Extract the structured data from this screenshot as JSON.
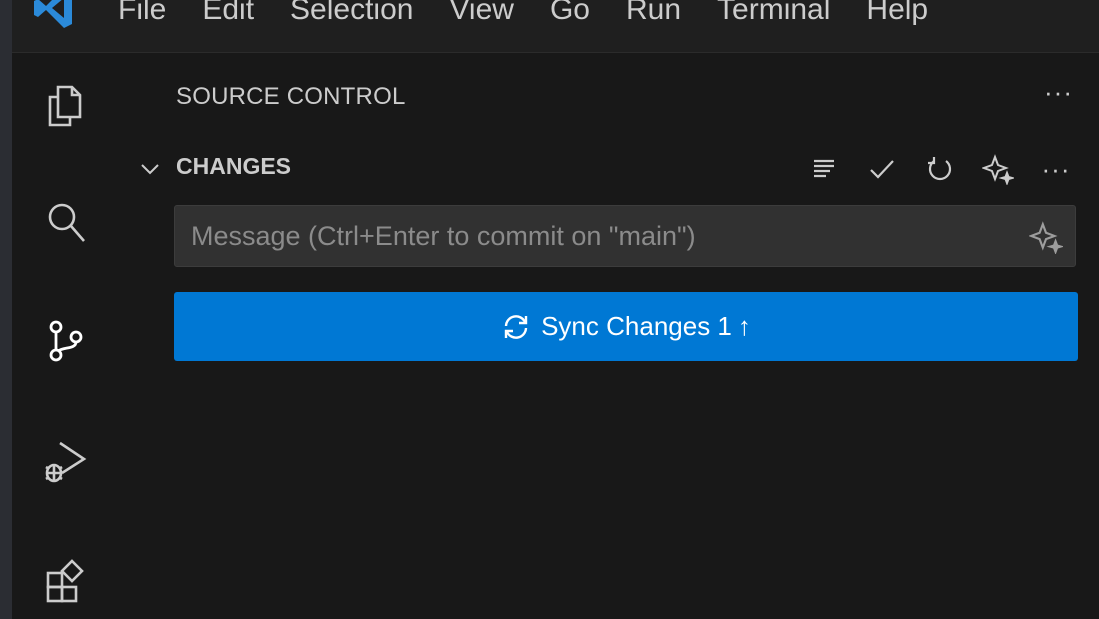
{
  "menubar": {
    "items": [
      "File",
      "Edit",
      "Selection",
      "View",
      "Go",
      "Run",
      "Terminal",
      "Help"
    ]
  },
  "activitybar": {
    "icons": [
      "explorer-icon",
      "search-icon",
      "source-control-icon",
      "run-debug-icon",
      "extensions-icon"
    ]
  },
  "sidebar": {
    "title": "SOURCE CONTROL",
    "more": "···",
    "section": {
      "label": "CHANGES",
      "actions": [
        "view-as-tree-icon",
        "commit-check-icon",
        "refresh-icon",
        "sparkle-icon",
        "more-actions-icon"
      ],
      "more": "···"
    },
    "commit": {
      "placeholder": "Message (Ctrl+Enter to commit on \"main\")",
      "value": ""
    },
    "sync": {
      "label": "Sync Changes 1",
      "arrow": "↑"
    }
  },
  "colors": {
    "background": "#1f1f1f",
    "panel": "#181818",
    "accent": "#0078d4",
    "text": "#cccccc"
  }
}
